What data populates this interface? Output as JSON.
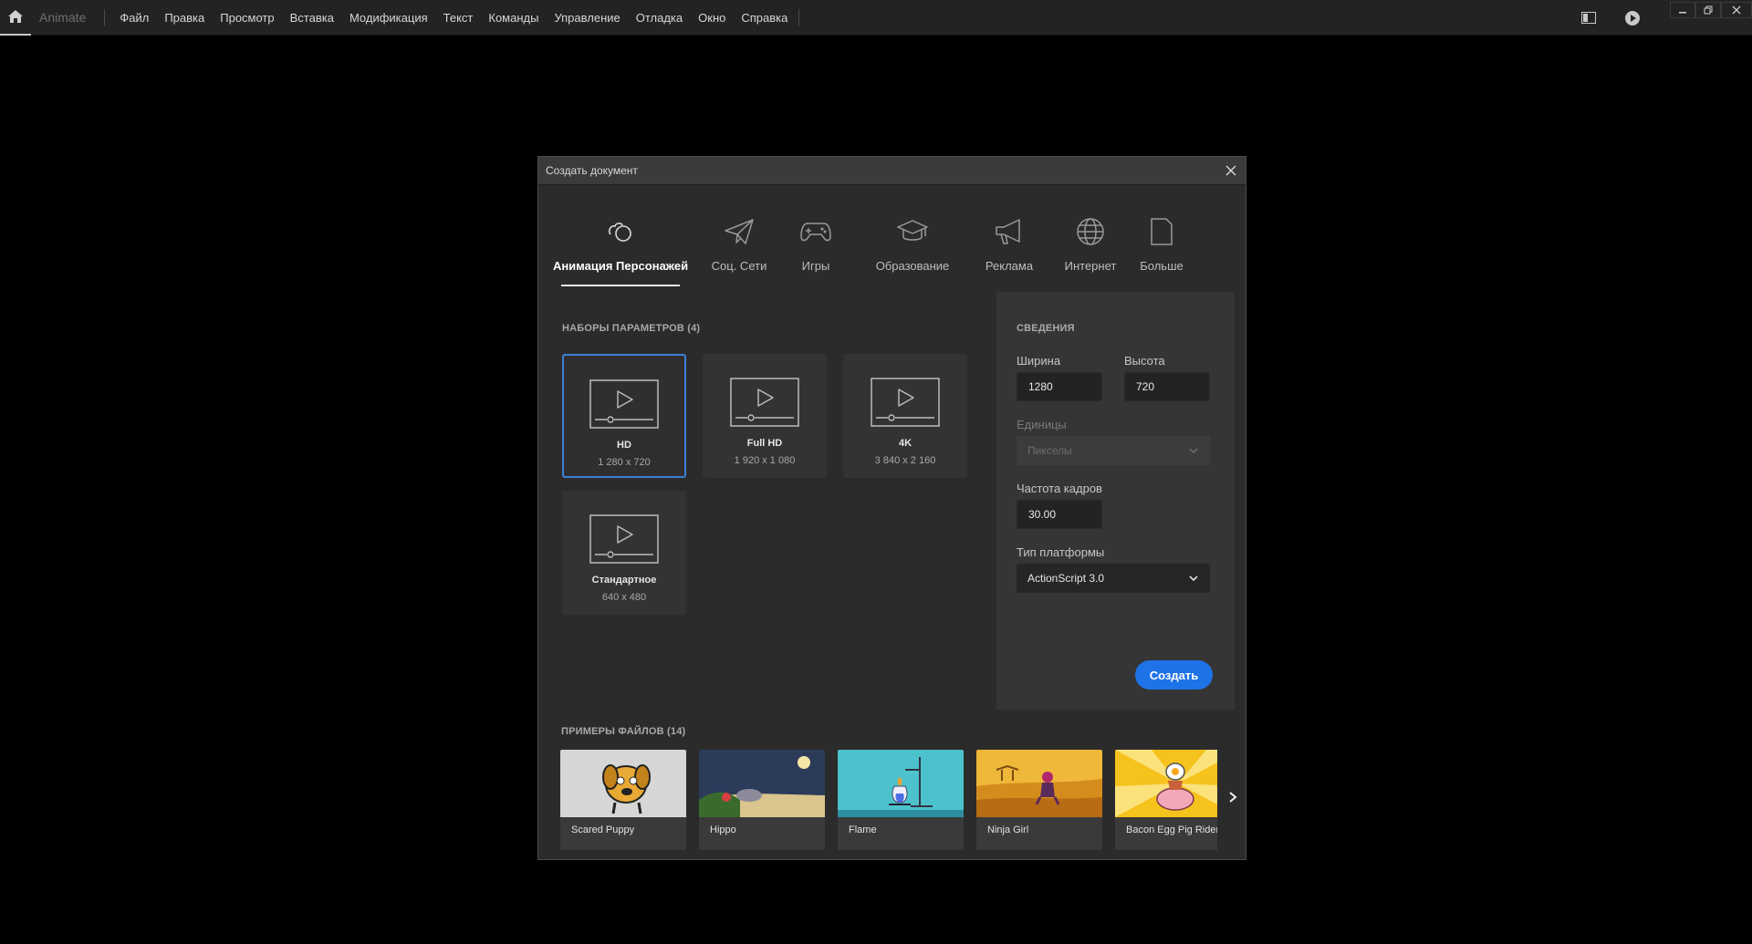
{
  "app": {
    "name": "Animate",
    "menu": [
      "Файл",
      "Правка",
      "Просмотр",
      "Вставка",
      "Модификация",
      "Текст",
      "Команды",
      "Управление",
      "Отладка",
      "Окно",
      "Справка"
    ],
    "icons": {
      "home": "home-icon",
      "panel": "panel-layout-icon",
      "play": "play-icon"
    }
  },
  "dialog": {
    "title": "Создать документ",
    "categories": [
      {
        "label": "Анимация Персонажей",
        "icon": "character-animation-icon",
        "active": true
      },
      {
        "label": "Соц. Сети",
        "icon": "paper-plane-icon",
        "active": false
      },
      {
        "label": "Игры",
        "icon": "gamepad-icon",
        "active": false
      },
      {
        "label": "Образование",
        "icon": "graduation-cap-icon",
        "active": false
      },
      {
        "label": "Реклама",
        "icon": "megaphone-icon",
        "active": false
      },
      {
        "label": "Интернет",
        "icon": "globe-icon",
        "active": false
      },
      {
        "label": "Больше",
        "icon": "document-icon",
        "active": false
      }
    ],
    "presets": {
      "title": "НАБОРЫ ПАРАМЕТРОВ (4)",
      "items": [
        {
          "name": "HD",
          "dims": "1 280 x 720",
          "selected": true
        },
        {
          "name": "Full HD",
          "dims": "1 920 x 1 080",
          "selected": false
        },
        {
          "name": "4K",
          "dims": "3 840 x 2 160",
          "selected": false
        },
        {
          "name": "Стандартное",
          "dims": "640 x 480",
          "selected": false
        }
      ]
    },
    "details": {
      "title": "СВЕДЕНИЯ",
      "width_label": "Ширина",
      "width_value": "1280",
      "height_label": "Высота",
      "height_value": "720",
      "units_label": "Единицы",
      "units_value": "Пикселы",
      "fps_label": "Частота кадров",
      "fps_value": "30.00",
      "platform_label": "Тип платформы",
      "platform_value": "ActionScript 3.0",
      "create_label": "Создать"
    },
    "samples": {
      "title": "ПРИМЕРЫ ФАЙЛОВ (14)",
      "items": [
        {
          "name": "Scared Puppy"
        },
        {
          "name": "Hippo"
        },
        {
          "name": "Flame"
        },
        {
          "name": "Ninja Girl"
        },
        {
          "name": "Bacon Egg Pig Rider"
        }
      ]
    }
  },
  "colors": {
    "accent": "#1f73e8",
    "selection_border": "#3b7fd6"
  }
}
